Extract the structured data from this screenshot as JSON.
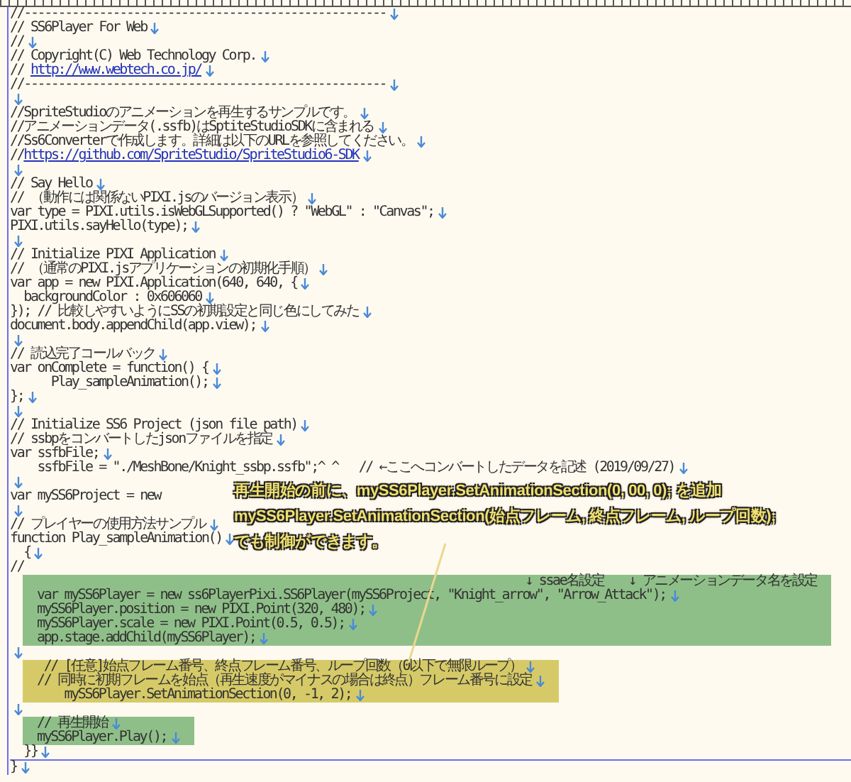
{
  "editor": {
    "blocks": [
      {
        "kind": "plain",
        "lines": [
          {
            "text": "//-----------------------------------------------------",
            "eol": true
          },
          {
            "text": "// SS6Player For Web",
            "eol": true
          },
          {
            "text": "//",
            "eol": true
          },
          {
            "text": "// Copyright(C) Web Technology Corp.",
            "eol": true
          },
          {
            "text": "// ",
            "link": "http://www.webtech.co.jp/",
            "eol": true
          },
          {
            "text": "//-----------------------------------------------------",
            "eol": true
          },
          {
            "eol": true
          },
          {
            "text": "//SpriteStudioのアニメーションを再生するサンプルです。",
            "eol": true
          },
          {
            "text": "//アニメーションデータ(.ssfb)はSptiteStudioSDKに含まれる",
            "eol": true
          },
          {
            "text": "//Ss6Converterで作成します。詳細は以下のURLを参照してください。",
            "eol": true
          },
          {
            "text": "//",
            "link": "https://github.com/SpriteStudio/SpriteStudio6-SDK",
            "eol": true
          },
          {
            "eol": true
          },
          {
            "text": "// Say Hello",
            "eol": true
          },
          {
            "text": "// （動作には関係ないPIXI.jsのバージョン表示）",
            "eol": true
          },
          {
            "text": "var type = PIXI.utils.isWebGLSupported() ? \"WebGL\" : \"Canvas\";",
            "eol": true
          },
          {
            "text": "PIXI.utils.sayHello(type);",
            "eol": true
          },
          {
            "eol": true
          },
          {
            "text": "// Initialize PIXI Application",
            "eol": true
          },
          {
            "text": "// （通常のPIXI.jsアプリケーションの初期化手順）",
            "eol": true
          },
          {
            "text": "var app = new PIXI.Application(640, 640, {",
            "eol": true
          },
          {
            "text": "  backgroundColor : 0x606060",
            "eol": true
          },
          {
            "text": "}); // 比較しやすいようにSSの初期設定と同じ色にしてみた",
            "eol": true
          },
          {
            "text": "document.body.appendChild(app.view);",
            "eol": true
          },
          {
            "eol": true
          },
          {
            "text": "// 読込完了コールバック",
            "eol": true
          },
          {
            "text": "var onComplete = function() {",
            "eol": true
          },
          {
            "text": "      Play_sampleAnimation();",
            "eol": true
          },
          {
            "text": "};",
            "eol": true
          },
          {
            "eol": true
          },
          {
            "text": "// Initialize SS6 Project (json file path)",
            "eol": true
          },
          {
            "text": "// ssbpをコンバートしたjsonファイルを指定",
            "eol": true
          },
          {
            "text": "var ssfbFile;",
            "eol": true
          },
          {
            "text": "    ssfbFile = \"./MeshBone/Knight_ssbp.ssfb\";^ ^   // ←ここへコンバートしたデータを記述 (2019/09/27)",
            "eol": true
          },
          {
            "eol": true
          },
          {
            "text": "var mySS6Project = new",
            "eol": false
          },
          {
            "eol": true
          },
          {
            "text": "// プレイヤーの使用方法サンプル",
            "eol": true
          },
          {
            "text": "function Play_sampleAnimation()",
            "eol": true
          },
          {
            "text": "  {",
            "eol": true
          },
          {
            "text": "//",
            "eol": false
          }
        ]
      },
      {
        "kind": "green",
        "lines": [
          {
            "text": "↓ ssae名設定　　↓ アニメーションデータ名を設定",
            "note": true,
            "eol": false
          },
          {
            "text": "var mySS6Player = new ss6PlayerPixi.SS6Player(mySS6Project, \"Knight_arrow\", \"Arrow_Attack\");",
            "eol": true
          },
          {
            "text": "mySS6Player.position = new PIXI.Point(320, 480);",
            "eol": true
          },
          {
            "text": "mySS6Player.scale = new PIXI.Point(0.5, 0.5);",
            "eol": true
          },
          {
            "text": "app.stage.addChild(mySS6Player);",
            "eol": true
          }
        ]
      },
      {
        "kind": "plain",
        "lines": [
          {
            "eol": true
          }
        ]
      },
      {
        "kind": "yellow",
        "lines": [
          {
            "text": " // [任意]始点フレーム番号、終点フレーム番号、ループ回数（0以下で無限ループ）",
            "eol": true
          },
          {
            "text": "// 同時に初期フレームを始点（再生速度がマイナスの場合は終点）フレーム番号に設定",
            "eol": true
          },
          {
            "text": "    mySS6Player.SetAnimationSection(0, -1, 2);",
            "eol": true
          }
        ]
      },
      {
        "kind": "plain",
        "lines": [
          {
            "eol": true
          }
        ]
      },
      {
        "kind": "green",
        "lines": [
          {
            "text": "// 再生開始",
            "eol": true
          },
          {
            "text": "mySS6Player.Play();",
            "eol": true
          }
        ]
      },
      {
        "kind": "plain",
        "lines": [
          {
            "text": "  }}",
            "eol": true,
            "cursor": true
          },
          {
            "text": "}",
            "eol": true
          }
        ]
      }
    ]
  },
  "callout": {
    "lines": [
      "再生開始の前に、mySS6Player.SetAnimationSection(0, 00, 0); を追加",
      "mySS6Player.SetAnimationSection(始点フレーム, 終点フレーム, ループ回数);",
      "でも制御ができます。"
    ]
  }
}
